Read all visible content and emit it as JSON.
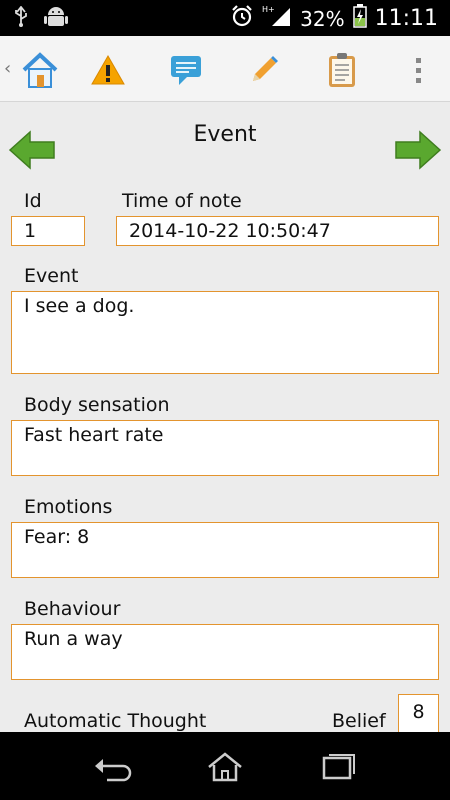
{
  "status_bar": {
    "battery": "32%",
    "time": "11:11",
    "network": "H+"
  },
  "action_bar": {
    "icons": [
      "home-icon",
      "warning-icon",
      "message-icon",
      "edit-icon",
      "clipboard-icon",
      "overflow-menu-icon"
    ]
  },
  "page": {
    "title": "Event"
  },
  "form": {
    "id_label": "Id",
    "id_value": "1",
    "time_label": "Time of note",
    "time_value": "2014-10-22 10:50:47",
    "event_label": "Event",
    "event_value": "I see a dog.",
    "body_label": "Body sensation",
    "body_value": "Fast heart rate",
    "emotions_label": "Emotions",
    "emotions_value": "Fear: 8",
    "behaviour_label": "Behaviour",
    "behaviour_value": "Run a way",
    "thought_label": "Automatic Thought",
    "belief_label": "Belief",
    "belief_value": "8"
  },
  "colors": {
    "field_border": "#e3942e",
    "arrow_green": "#5aa82f"
  }
}
